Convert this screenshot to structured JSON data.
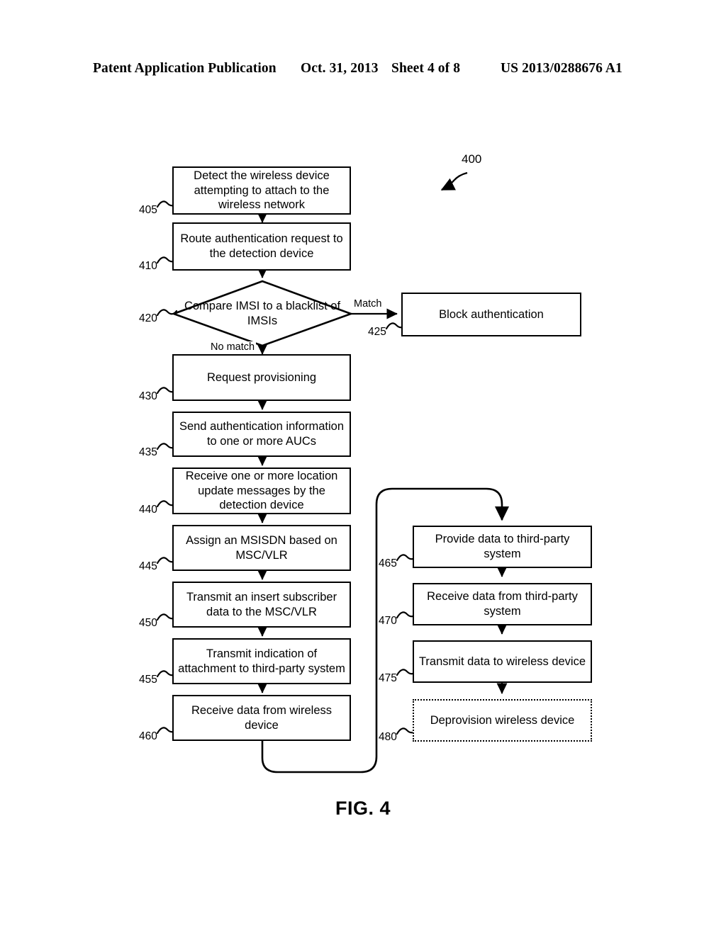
{
  "header": {
    "publication": "Patent Application Publication",
    "date": "Oct. 31, 2013",
    "sheet": "Sheet 4 of 8",
    "patent_number": "US 2013/0288676 A1"
  },
  "figure": {
    "caption": "FIG. 4",
    "tag": "400"
  },
  "nodes": [
    {
      "ref": "405",
      "text": "Detect the wireless device attempting to attach to the wireless network",
      "shape": "process",
      "border": "solid"
    },
    {
      "ref": "410",
      "text": "Route authentication request to the detection device",
      "shape": "process",
      "border": "solid"
    },
    {
      "ref": "420",
      "text": "Compare IMSI to a blacklist of IMSIs",
      "shape": "decision",
      "border": "solid"
    },
    {
      "ref": "425",
      "text": "Block authentication",
      "shape": "process",
      "border": "solid"
    },
    {
      "ref": "430",
      "text": "Request provisioning",
      "shape": "process",
      "border": "solid"
    },
    {
      "ref": "435",
      "text": "Send authentication information to one or more AUCs",
      "shape": "process",
      "border": "solid"
    },
    {
      "ref": "440",
      "text": "Receive one or more location update messages by the detection device",
      "shape": "process",
      "border": "solid"
    },
    {
      "ref": "445",
      "text": "Assign an MSISDN based on MSC/VLR",
      "shape": "process",
      "border": "solid"
    },
    {
      "ref": "450",
      "text": "Transmit an insert subscriber data to the MSC/VLR",
      "shape": "process",
      "border": "solid"
    },
    {
      "ref": "455",
      "text": "Transmit indication of attachment to third-party system",
      "shape": "process",
      "border": "solid"
    },
    {
      "ref": "460",
      "text": "Receive data from wireless device",
      "shape": "process",
      "border": "solid"
    },
    {
      "ref": "465",
      "text": "Provide data to third-party system",
      "shape": "process",
      "border": "solid"
    },
    {
      "ref": "470",
      "text": "Receive data from third-party system",
      "shape": "process",
      "border": "solid"
    },
    {
      "ref": "475",
      "text": "Transmit data to wireless device",
      "shape": "process",
      "border": "solid"
    },
    {
      "ref": "480",
      "text": "Deprovision wireless device",
      "shape": "process",
      "border": "dotted"
    }
  ],
  "edge_labels": {
    "match": "Match",
    "no_match": "No match"
  },
  "colors": {
    "stroke": "#000000",
    "background": "#ffffff"
  }
}
